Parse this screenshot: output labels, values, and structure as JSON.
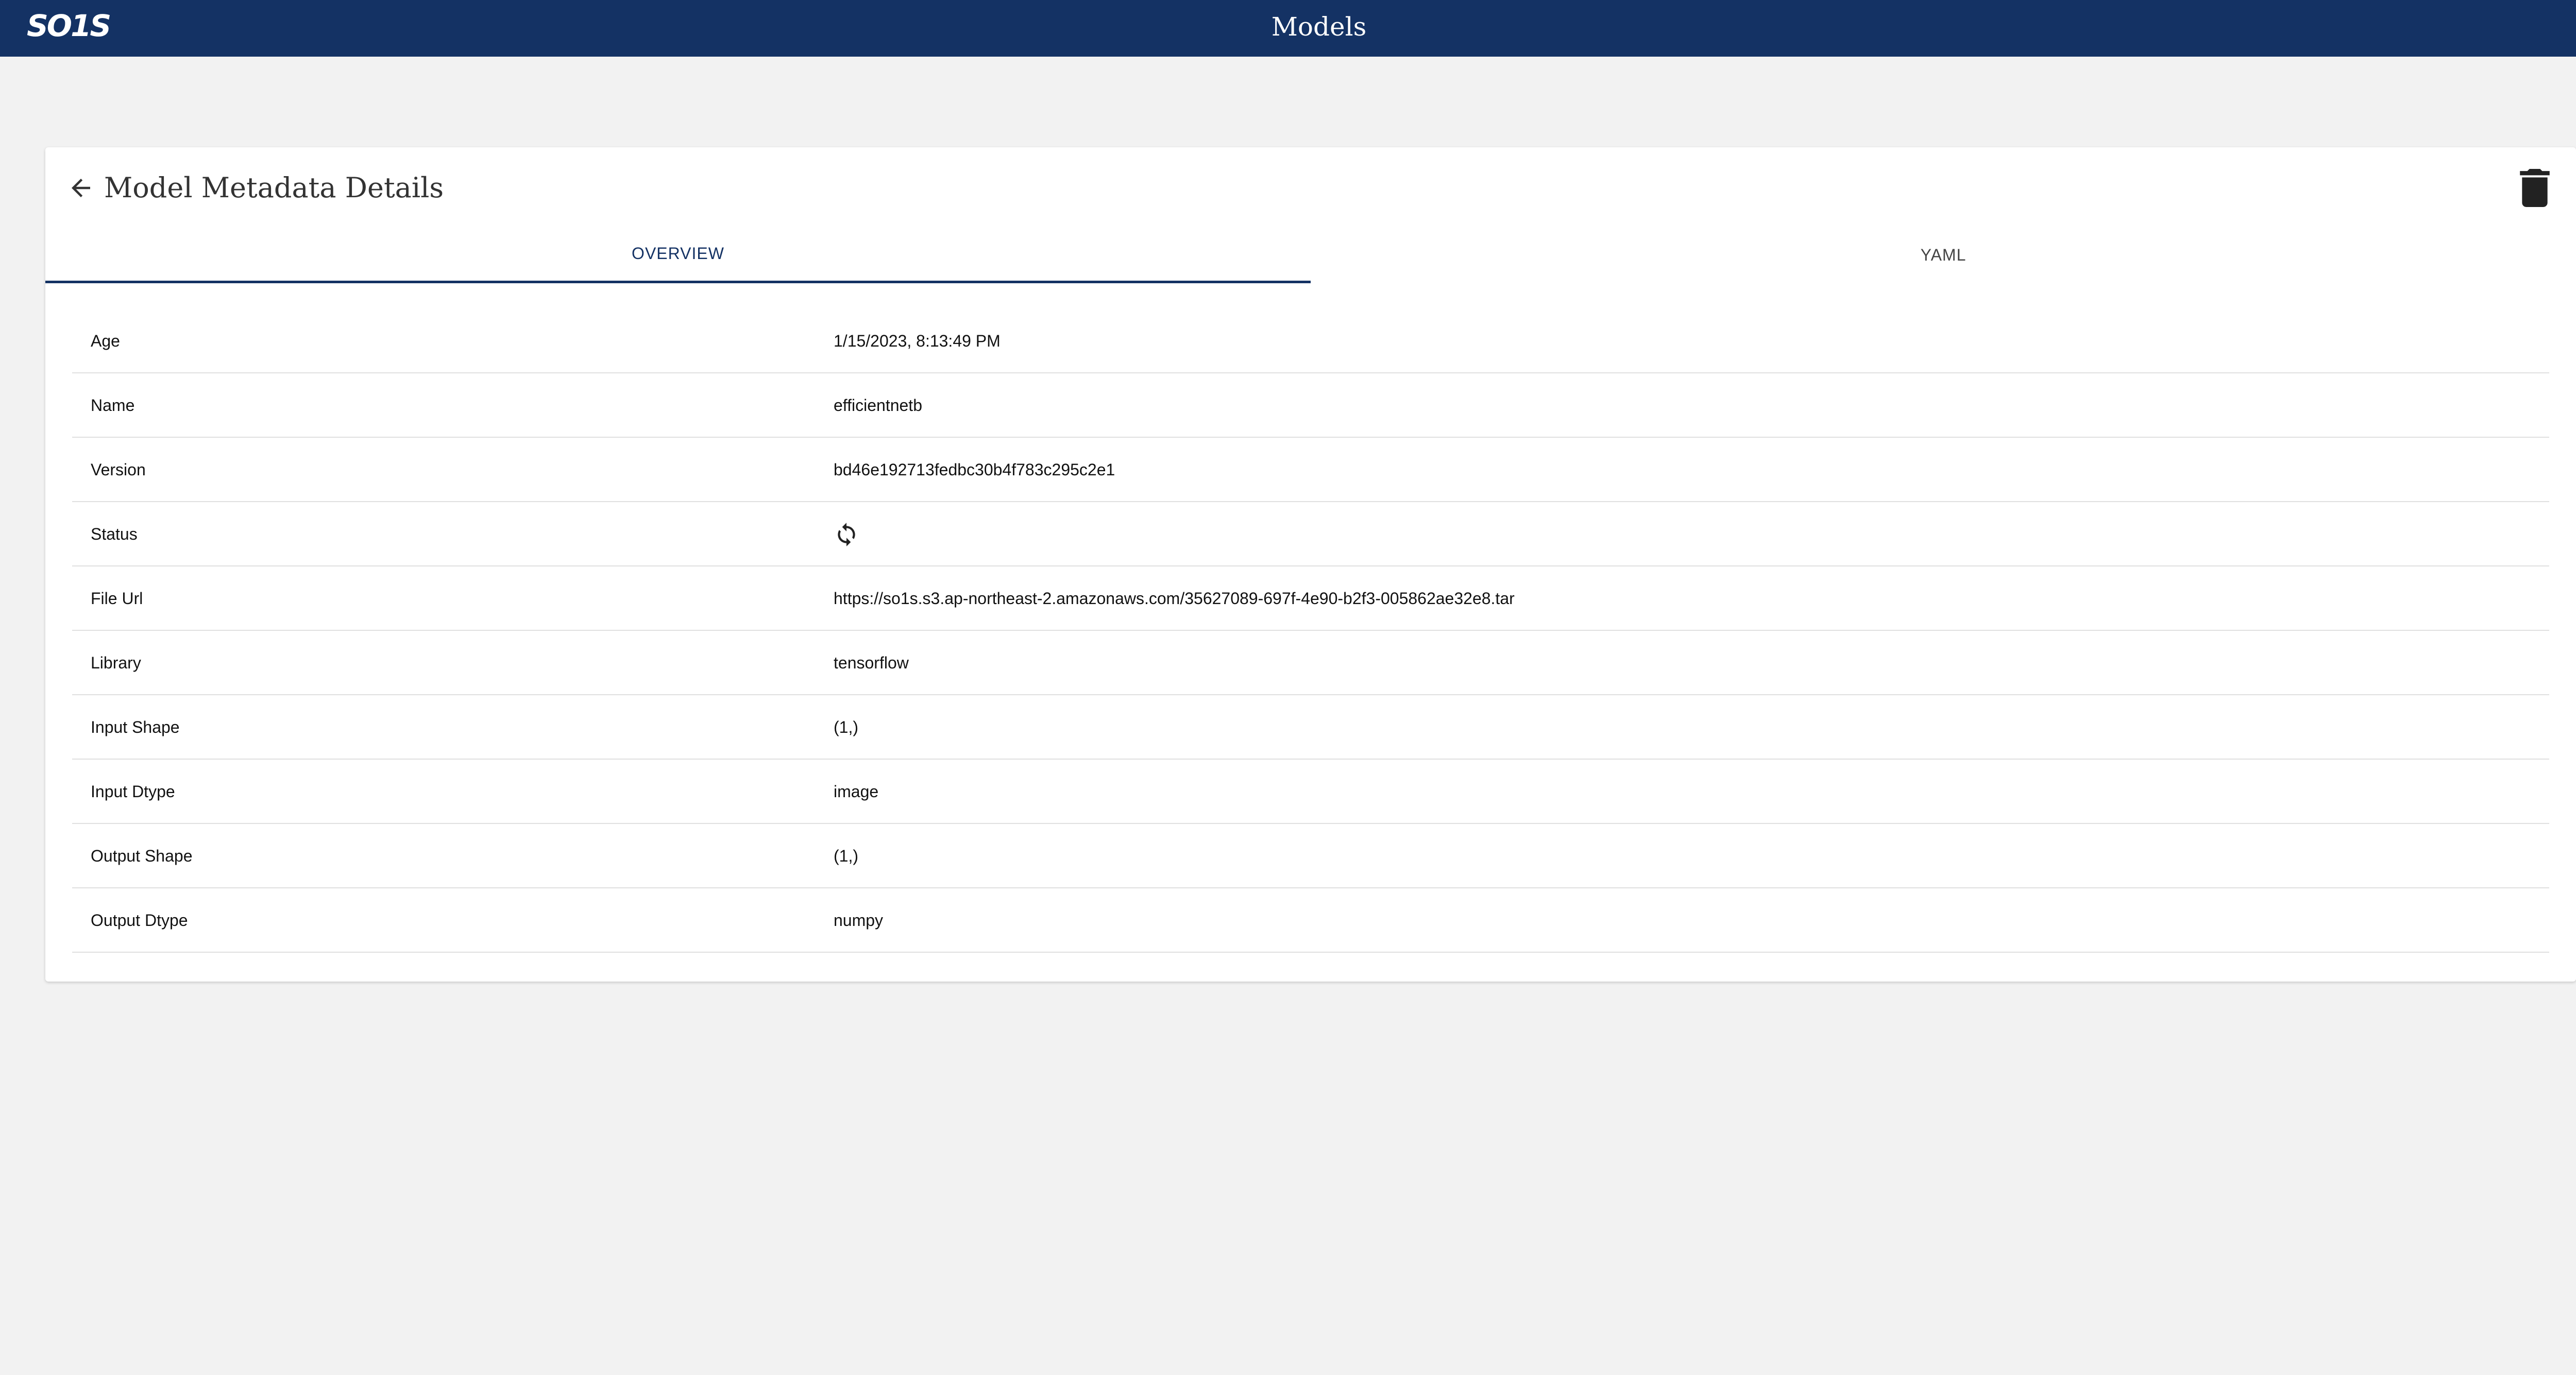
{
  "app": {
    "logo": "SO1S",
    "title": "Models"
  },
  "card": {
    "title": "Model Metadata Details"
  },
  "tabs": [
    {
      "label": "OVERVIEW",
      "active": true
    },
    {
      "label": "YAML",
      "active": false
    }
  ],
  "rows": [
    {
      "key": "Age",
      "value": "1/15/2023, 8:13:49 PM"
    },
    {
      "key": "Name",
      "value": "efficientnetb"
    },
    {
      "key": "Version",
      "value": "bd46e192713fedbc30b4f783c295c2e1"
    },
    {
      "key": "Status",
      "value": null,
      "icon": "sync-icon"
    },
    {
      "key": "File Url",
      "value": "https://so1s.s3.ap-northeast-2.amazonaws.com/35627089-697f-4e90-b2f3-005862ae32e8.tar"
    },
    {
      "key": "Library",
      "value": "tensorflow"
    },
    {
      "key": "Input Shape",
      "value": "(1,)"
    },
    {
      "key": "Input Dtype",
      "value": "image"
    },
    {
      "key": "Output Shape",
      "value": "(1,)"
    },
    {
      "key": "Output Dtype",
      "value": "numpy"
    }
  ],
  "icons": {
    "logout": "logout-icon",
    "back": "arrow-back-icon",
    "delete": "trash-icon"
  },
  "colors": {
    "header": "#143264",
    "accent": "#143264",
    "background": "#f2f2f2"
  }
}
